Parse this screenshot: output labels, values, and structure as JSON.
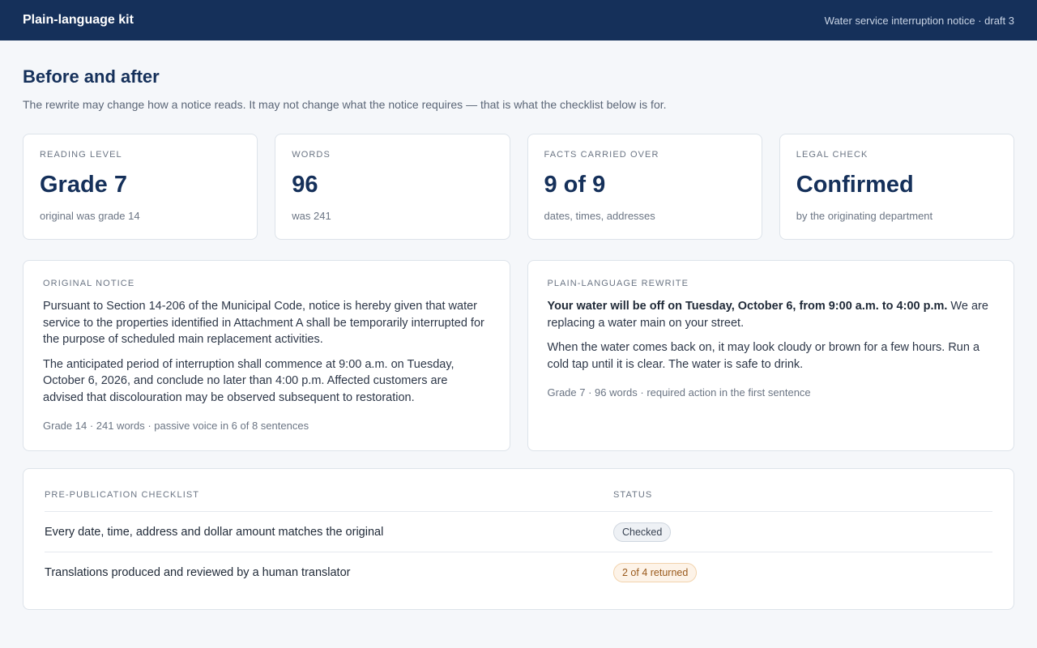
{
  "header": {
    "brand": "Plain-language kit",
    "document": "Water service interruption notice · draft 3"
  },
  "page": {
    "title": "Before and after",
    "subtitle": "The rewrite may change how a notice reads. It may not change what the notice requires — that is what the checklist below is for."
  },
  "stats": [
    {
      "label": "Reading level",
      "value": "Grade 7",
      "note": "original was grade 14"
    },
    {
      "label": "Words",
      "value": "96",
      "note": "was 241"
    },
    {
      "label": "Facts carried over",
      "value": "9 of 9",
      "note": "dates, times, addresses"
    },
    {
      "label": "Legal check",
      "value": "Confirmed",
      "note": "by the originating department"
    }
  ],
  "original": {
    "label": "Original notice",
    "paragraphs": [
      "Pursuant to Section 14-206 of the Municipal Code, notice is hereby given that water service to the properties identified in Attachment A shall be temporarily interrupted for the purpose of scheduled main replacement activities.",
      "The anticipated period of interruption shall commence at 9:00 a.m. on Tuesday, October 6, 2026, and conclude no later than 4:00 p.m. Affected customers are advised that discolouration may be observed subsequent to restoration."
    ],
    "meta": "Grade 14 · 241 words · passive voice in 6 of 8 sentences"
  },
  "rewrite": {
    "label": "Plain-language rewrite",
    "lead_bold": "Your water will be off on Tuesday, October 6, from 9:00 a.m. to 4:00 p.m.",
    "lead_rest": " We are replacing a water main on your street.",
    "paragraph2": "When the water comes back on, it may look cloudy or brown for a few hours. Run a cold tap until it is clear. The water is safe to drink.",
    "meta": "Grade 7 · 96 words · required action in the first sentence"
  },
  "checklist": {
    "col_item": "Pre-publication checklist",
    "col_status": "Status",
    "rows": [
      {
        "item": "Every date, time, address and dollar amount matches the original",
        "status": "Checked"
      },
      {
        "item": "Translations produced and reviewed by a human translator",
        "status": "2 of 4 returned"
      }
    ]
  }
}
